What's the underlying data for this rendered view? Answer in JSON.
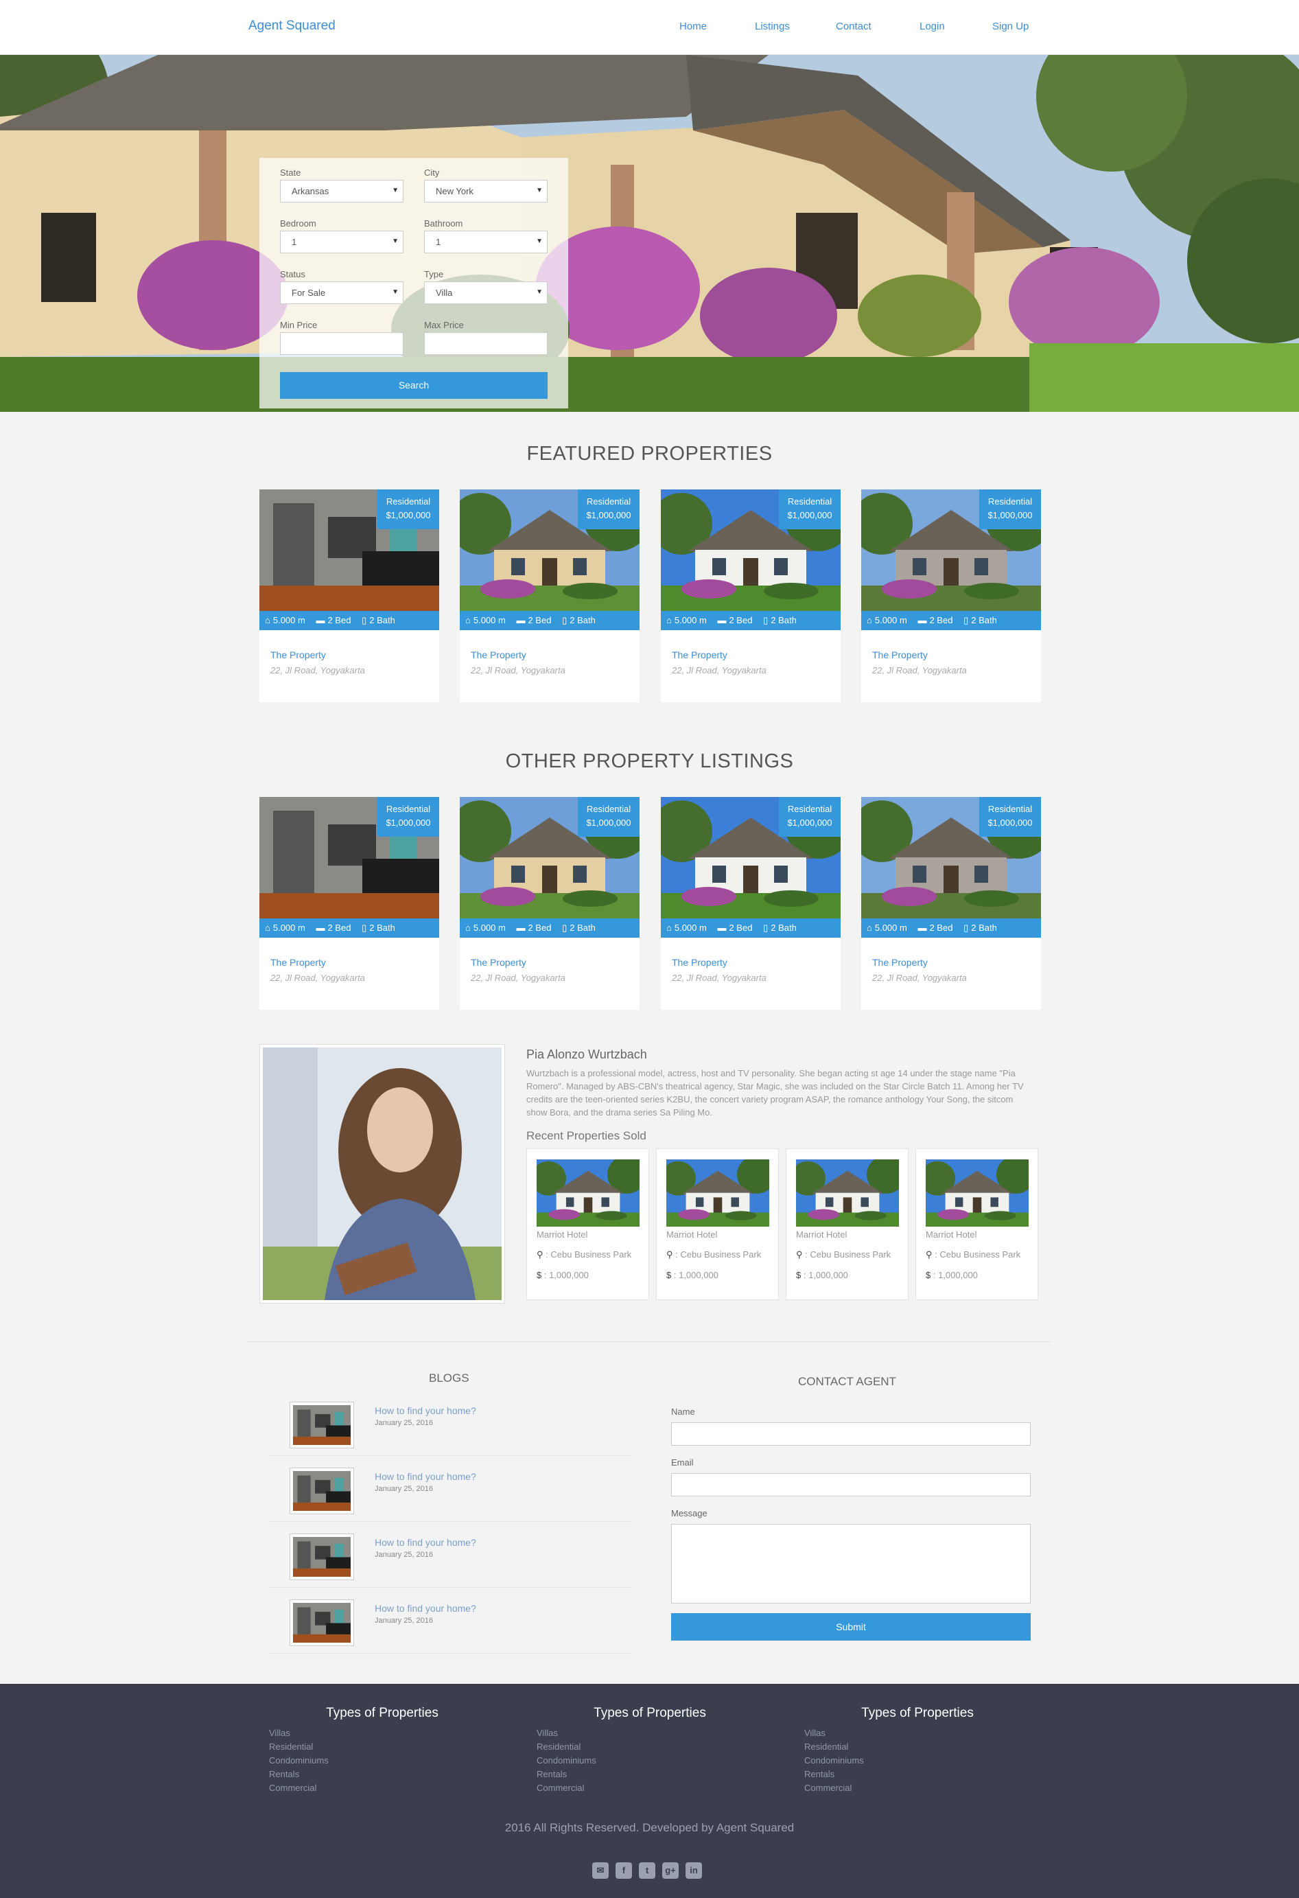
{
  "nav": {
    "brand": "Agent Squared",
    "links": [
      "Home",
      "Listings",
      "Contact",
      "Login",
      "Sign Up"
    ]
  },
  "search": {
    "state_label": "State",
    "state_value": "Arkansas",
    "city_label": "City",
    "city_value": "New York",
    "bedroom_label": "Bedroom",
    "bedroom_value": "1",
    "bathroom_label": "Bathroom",
    "bathroom_value": "1",
    "status_label": "Status",
    "status_value": "For Sale",
    "type_label": "Type",
    "type_value": "Villa",
    "min_price_label": "Min Price",
    "max_price_label": "Max Price",
    "button": "Search"
  },
  "featured": {
    "title": "FEATURED PROPERTIES",
    "cards": [
      {
        "badge_type": "Residential",
        "badge_price": "$1,000,000",
        "area": "5.000 m",
        "bed": "2 Bed",
        "bath": "2 Bath",
        "title": "The Property",
        "address": "22, Jl Road, Yogyakarta"
      },
      {
        "badge_type": "Residential",
        "badge_price": "$1,000,000",
        "area": "5.000 m",
        "bed": "2 Bed",
        "bath": "2 Bath",
        "title": "The Property",
        "address": "22, Jl Road, Yogyakarta"
      },
      {
        "badge_type": "Residential",
        "badge_price": "$1,000,000",
        "area": "5.000 m",
        "bed": "2 Bed",
        "bath": "2 Bath",
        "title": "The Property",
        "address": "22, Jl Road, Yogyakarta"
      },
      {
        "badge_type": "Residential",
        "badge_price": "$1,000,000",
        "area": "5.000 m",
        "bed": "2 Bed",
        "bath": "2 Bath",
        "title": "The Property",
        "address": "22, Jl Road, Yogyakarta"
      }
    ]
  },
  "other": {
    "title": "OTHER PROPERTY LISTINGS",
    "cards": [
      {
        "badge_type": "Residential",
        "badge_price": "$1,000,000",
        "area": "5.000 m",
        "bed": "2 Bed",
        "bath": "2 Bath",
        "title": "The Property",
        "address": "22, Jl Road, Yogyakarta"
      },
      {
        "badge_type": "Residential",
        "badge_price": "$1,000,000",
        "area": "5.000 m",
        "bed": "2 Bed",
        "bath": "2 Bath",
        "title": "The Property",
        "address": "22, Jl Road, Yogyakarta"
      },
      {
        "badge_type": "Residential",
        "badge_price": "$1,000,000",
        "area": "5.000 m",
        "bed": "2 Bed",
        "bath": "2 Bath",
        "title": "The Property",
        "address": "22, Jl Road, Yogyakarta"
      },
      {
        "badge_type": "Residential",
        "badge_price": "$1,000,000",
        "area": "5.000 m",
        "bed": "2 Bed",
        "bath": "2 Bath",
        "title": "The Property",
        "address": "22, Jl Road, Yogyakarta"
      }
    ]
  },
  "agent": {
    "name": "Pia Alonzo Wurtzbach",
    "bio": "Wurtzbach is a professional model, actress, host and TV personality. She began acting st age 14 under the stage name \"Pia Romero\". Managed by ABS-CBN's theatrical agency, Star Magic, she was included on the Star Circle Batch 11. Among her TV credits are the teen-oriented series K2BU, the concert variety program ASAP, the romance anthology Your Song, the sitcom show Bora, and the drama series Sa Piling Mo.",
    "recent_title": "Recent Properties Sold",
    "recent": [
      {
        "name": "Marriot Hotel",
        "location": ": Cebu Business Park",
        "price": ": 1,000,000"
      },
      {
        "name": "Marriot Hotel",
        "location": ": Cebu Business Park",
        "price": ": 1,000,000"
      },
      {
        "name": "Marriot Hotel",
        "location": ": Cebu Business Park",
        "price": ": 1,000,000"
      },
      {
        "name": "Marriot Hotel",
        "location": ": Cebu Business Park",
        "price": ": 1,000,000"
      }
    ]
  },
  "blogs": {
    "title": "BLOGS",
    "items": [
      {
        "title": "How to find your home?",
        "date": "January 25, 2016"
      },
      {
        "title": "How to find your home?",
        "date": "January 25, 2016"
      },
      {
        "title": "How to find your home?",
        "date": "January 25, 2016"
      },
      {
        "title": "How to find your home?",
        "date": "January 25, 2016"
      }
    ]
  },
  "contact": {
    "title": "CONTACT AGENT",
    "name_label": "Name",
    "email_label": "Email",
    "message_label": "Message",
    "submit": "Submit"
  },
  "footer": {
    "columns": [
      {
        "title": "Types of Properties",
        "items": [
          "Villas",
          "Residential",
          "Condominiums",
          "Rentals",
          "Commercial"
        ]
      },
      {
        "title": "Types of Properties",
        "items": [
          "Villas",
          "Residential",
          "Condominiums",
          "Rentals",
          "Commercial"
        ]
      },
      {
        "title": "Types of Properties",
        "items": [
          "Villas",
          "Residential",
          "Condominiums",
          "Rentals",
          "Commercial"
        ]
      }
    ],
    "copyright": "2016 All Rights Reserved. Developed by Agent Squared",
    "socials": [
      "envelope-icon",
      "facebook-icon",
      "twitter-icon",
      "google-plus-icon",
      "linkedin-icon"
    ]
  },
  "colors": {
    "accent": "#3498db",
    "link": "#3d8ed9",
    "footer_bg": "#3b3f4d",
    "page_bg": "#f3f3f3"
  }
}
